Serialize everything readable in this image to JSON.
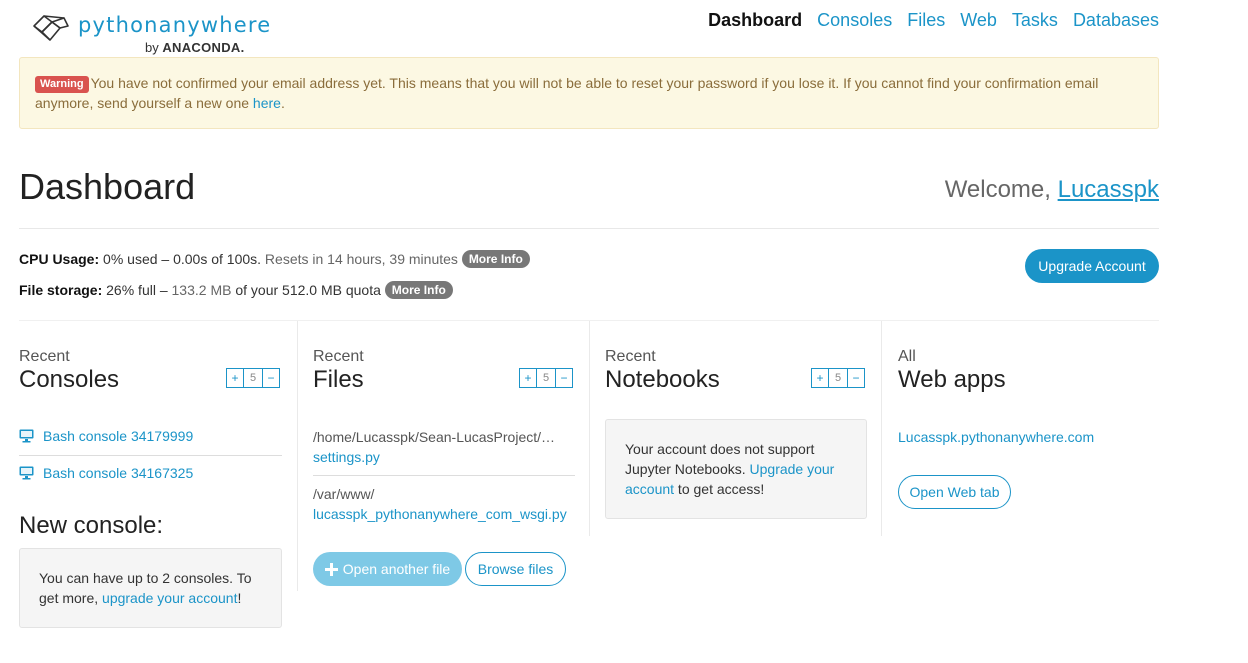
{
  "brand": {
    "name": "pythonanywhere",
    "by_prefix": "by",
    "by_company": "ANACONDA."
  },
  "nav": {
    "items": [
      "Dashboard",
      "Consoles",
      "Files",
      "Web",
      "Tasks",
      "Databases"
    ],
    "active": "Dashboard"
  },
  "alert": {
    "badge": "Warning",
    "text": "You have not confirmed your email address yet. This means that you will not be able to reset your password if you lose it. If you cannot find your confirmation email anymore, send yourself a new one ",
    "link": "here",
    "end": "."
  },
  "page": {
    "title": "Dashboard",
    "welcome_prefix": "Welcome, ",
    "username": "Lucasspk"
  },
  "usage": {
    "cpu_label": "CPU Usage:",
    "cpu_value": "0% used – 0.00s of 100s.",
    "cpu_reset": "Resets in 14 hours, 39 minutes",
    "storage_label": "File storage:",
    "storage_value_a": "26% full –",
    "storage_value_b": "133.2 MB",
    "storage_value_c": "of your 512.0 MB quota",
    "more_info": "More Info",
    "upgrade": "Upgrade Account"
  },
  "consoles": {
    "kicker": "Recent",
    "title": "Consoles",
    "plus": "+",
    "count": "5",
    "minus": "−",
    "items": [
      "Bash console 34179999",
      "Bash console 34167325"
    ],
    "new_title": "New console:",
    "well_text": "You can have up to 2 consoles. To get more, ",
    "well_link": "upgrade your account",
    "well_end": "!"
  },
  "files": {
    "kicker": "Recent",
    "title": "Files",
    "plus": "+",
    "count": "5",
    "minus": "−",
    "items": [
      {
        "path": "/home/Lucasspk/Sean-LucasProject/…",
        "name": "settings.py"
      },
      {
        "path": "/var/www/",
        "name": "lucasspk_pythonanywhere_com_wsgi.py"
      }
    ],
    "open_another": "Open another file",
    "browse": "Browse files"
  },
  "notebooks": {
    "kicker": "Recent",
    "title": "Notebooks",
    "plus": "+",
    "count": "5",
    "minus": "−",
    "well_text": "Your account does not support Jupyter Notebooks. ",
    "well_link": "Upgrade your account",
    "well_end": " to get access!"
  },
  "webapps": {
    "kicker": "All",
    "title": "Web apps",
    "items": [
      "Lucasspk.pythonanywhere.com"
    ],
    "open_tab": "Open Web tab"
  },
  "icons": {
    "logo": "pythonanywhere-logo-icon",
    "console": "monitor-icon",
    "plus": "plus-icon"
  },
  "colors": {
    "accent": "#1b94c8",
    "accent_light": "#7ec9e6",
    "warning_bg": "#fcf8e3",
    "warning_text": "#8a6d3b",
    "badge_red": "#d9534f"
  }
}
